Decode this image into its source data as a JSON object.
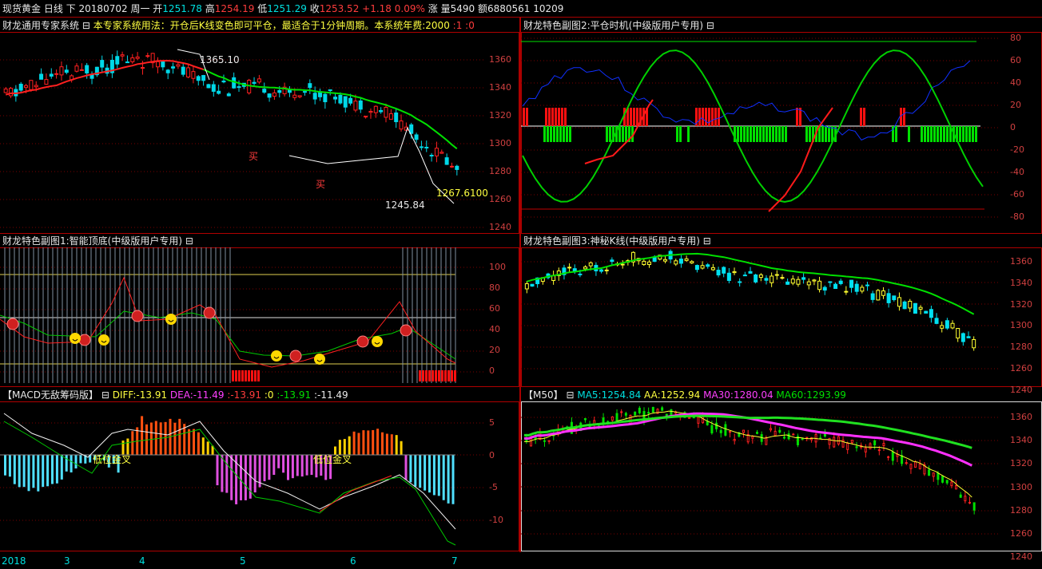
{
  "quote": {
    "name": "现货黄金",
    "period": "日线",
    "tail": "下",
    "date": "20180702",
    "weekday": "周一",
    "open_label": "开",
    "open": "1251.78",
    "high_label": "高",
    "high": "1254.19",
    "low_label": "低",
    "low": "1251.29",
    "close_label": "收",
    "close": "1253.52",
    "change": "+1.18",
    "change_pct": "0.09%",
    "rise_label": "涨",
    "vol_label": "量",
    "vol": "5490",
    "amt_label": "额",
    "amt": "6880561",
    "extra": "10209"
  },
  "main_panel": {
    "title": "财龙通用专家系统",
    "note": "本专家系统用法：开仓后K线变色即可平仓，最适合于1分钟周期。本系统年费:2000",
    "suffix1": ":1",
    "suffix2": ":0",
    "peak_label": "1365.10",
    "trough_label": "1245.84",
    "price_label": "1267.6100",
    "buy_label": "买",
    "ticks": [
      "1360",
      "1340",
      "1320",
      "1300",
      "1280",
      "1260",
      "1240"
    ]
  },
  "sub1": {
    "title": "财龙特色副图1:智能顶底(中级版用户专用)",
    "ticks": [
      "100",
      "80",
      "60",
      "40",
      "20",
      "0"
    ]
  },
  "sub2": {
    "title": "财龙特色副图2:平仓时机(中级版用户专用)",
    "ticks": [
      "80",
      "60",
      "40",
      "20",
      "0",
      "-20",
      "-40",
      "-60",
      "-80"
    ]
  },
  "sub3": {
    "title": "财龙特色副图3:神秘K线(中级版用户专用)",
    "ticks": [
      "1360",
      "1340",
      "1320",
      "1300",
      "1280",
      "1260",
      "1240"
    ]
  },
  "macd": {
    "title": "【MACD无敌筹码版】",
    "diff_label": "DIFF:",
    "diff": "-13.91",
    "dea_label": "DEA:",
    "dea": "-11.49",
    "v1": ":-13.91",
    "v2": ":0",
    "v3": ":-13.91",
    "v4": ":-11.49",
    "cross_label": "低位金叉",
    "ticks": [
      "5",
      "0",
      "-5",
      "-10"
    ]
  },
  "ma": {
    "title": "【M50】",
    "ma5_label": "MA5:",
    "ma5": "1254.84",
    "aa_label": "AA:",
    "aa": "1252.94",
    "ma30_label": "MA30:",
    "ma30": "1280.04",
    "ma60_label": "MA60:",
    "ma60": "1293.99",
    "ticks": [
      "1360",
      "1340",
      "1320",
      "1300",
      "1280",
      "1260",
      "1240"
    ]
  },
  "xaxis": [
    "2018",
    "3",
    "4",
    "5",
    "6",
    "7"
  ],
  "colors": {
    "up": "#ff3030",
    "down": "#00e0e0",
    "green": "#00e000",
    "border": "#b00000"
  }
}
